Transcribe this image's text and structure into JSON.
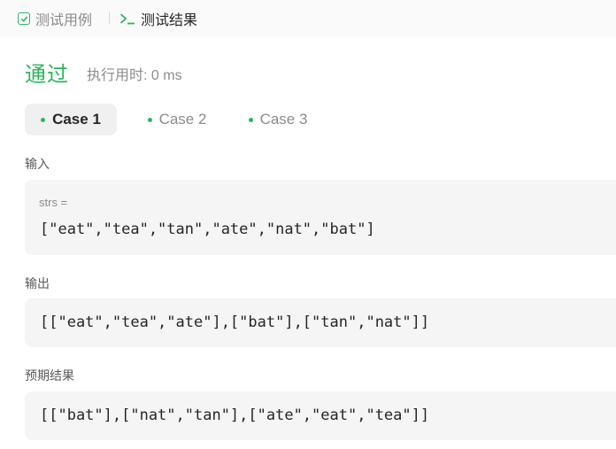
{
  "tabs": {
    "cases_label": "测试用例",
    "result_label": "测试结果"
  },
  "status": {
    "text": "通过",
    "runtime": "执行用时: 0 ms"
  },
  "case_tabs": [
    "Case 1",
    "Case 2",
    "Case 3"
  ],
  "input": {
    "label": "输入",
    "var_name": "strs =",
    "value": "[\"eat\",\"tea\",\"tan\",\"ate\",\"nat\",\"bat\"]"
  },
  "output": {
    "label": "输出",
    "value": "[[\"eat\",\"tea\",\"ate\"],[\"bat\"],[\"tan\",\"nat\"]]"
  },
  "expected": {
    "label": "预期结果",
    "value": "[[\"bat\"],[\"nat\",\"tan\"],[\"ate\",\"eat\",\"tea\"]]"
  },
  "colors": {
    "accent": "#2db55d",
    "box_bg": "#f5f5f5",
    "muted_text": "#8c8c8c"
  },
  "icons": [
    "checkbox-icon",
    "terminal-icon",
    "case-status-dot-icon"
  ]
}
